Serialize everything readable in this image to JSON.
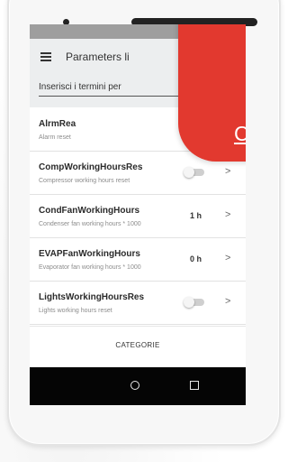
{
  "toolbar": {
    "title": "Parameters li"
  },
  "search": {
    "text": "Inserisci i termini per"
  },
  "parameters": [
    {
      "name": "AlrmRea",
      "description": "Alarm reset",
      "control": "none",
      "value": ""
    },
    {
      "name": "CompWorkingHoursRes",
      "description": "Compressor working hours reset",
      "control": "toggle",
      "value": ""
    },
    {
      "name": "CondFanWorkingHours",
      "description": "Condenser fan working hours * 1000",
      "control": "value",
      "value": "1 h"
    },
    {
      "name": "EVAPFanWorkingHours",
      "description": "Evaporator fan working hours * 1000",
      "control": "value",
      "value": "0 h"
    },
    {
      "name": "LightsWorkingHoursRes",
      "description": "Lights working hours reset",
      "control": "toggle",
      "value": ""
    }
  ],
  "chevron": ">",
  "bottom_tab": {
    "label": "CATEGORIE"
  },
  "promo": {
    "text": "CA"
  },
  "icons": {
    "menu": "hamburger-menu-icon",
    "home": "home-circle-icon",
    "recents": "recents-square-icon",
    "chevron": "chevron-right-icon"
  },
  "colors": {
    "promo": "#e2392f",
    "toolbar": "#eceeef",
    "statusbar": "#9e9e9e",
    "navbar": "#050505"
  }
}
